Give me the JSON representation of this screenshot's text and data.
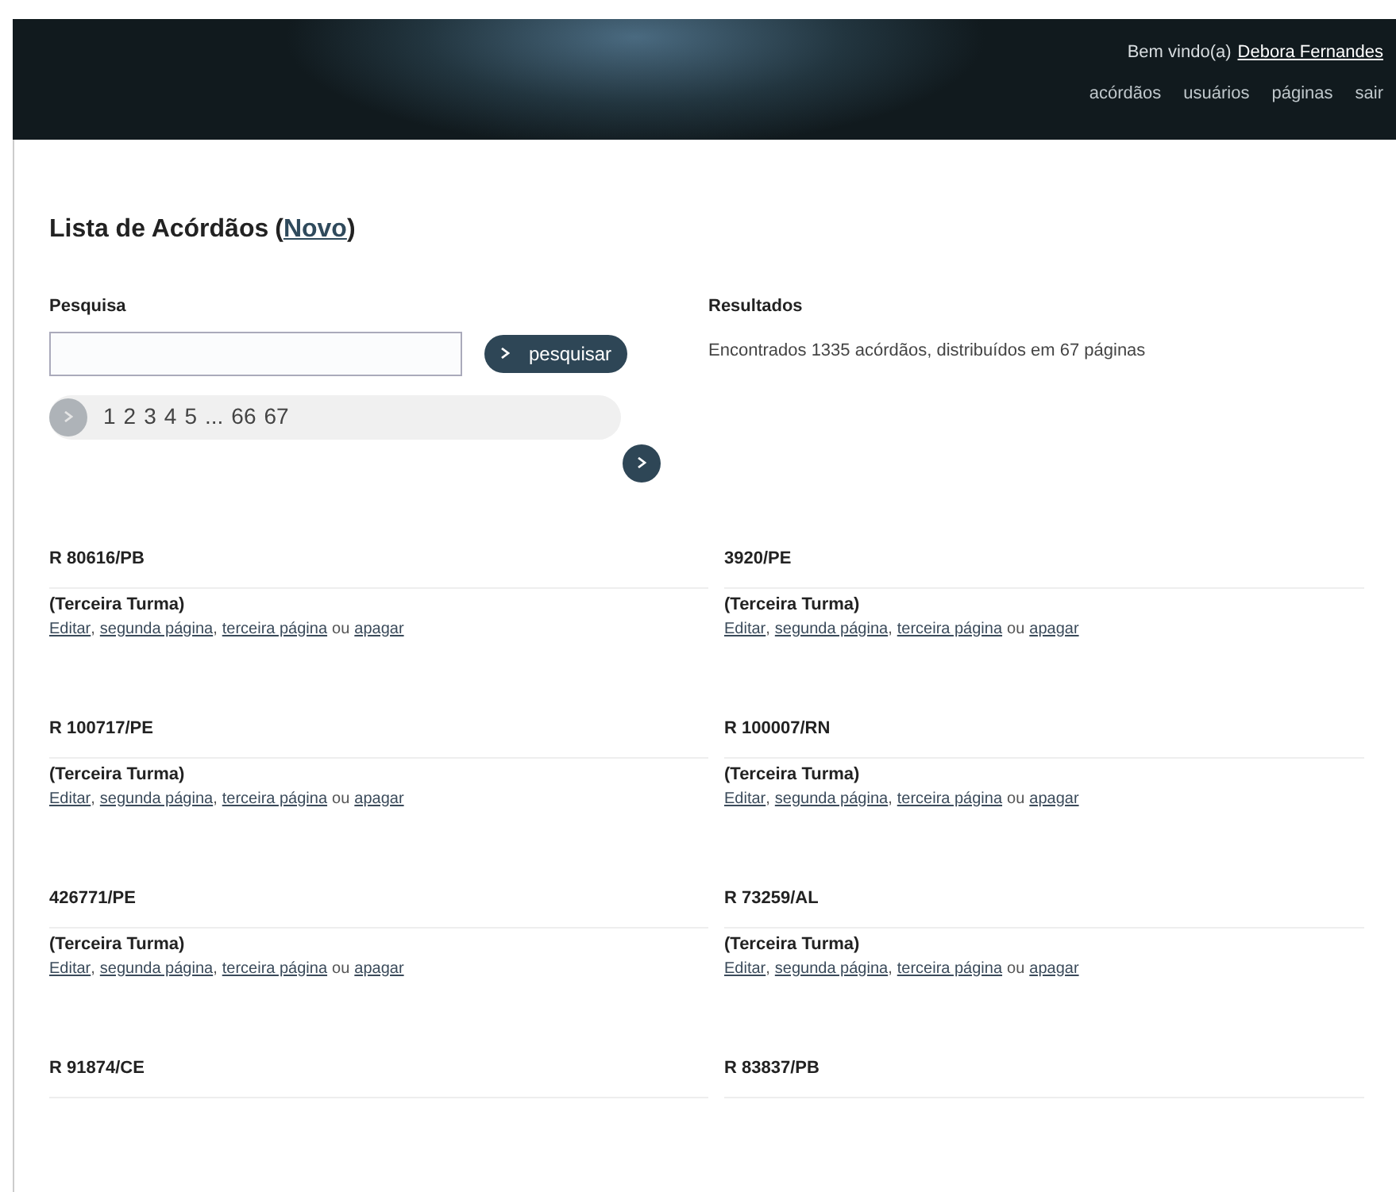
{
  "header": {
    "greeting": "Bem vindo(a)",
    "user": "Debora Fernandes",
    "nav": [
      "acórdãos",
      "usuários",
      "páginas",
      "sair"
    ]
  },
  "title": {
    "text": "Lista de Acórdãos",
    "paren_open": "(",
    "link": "Novo",
    "paren_close": ")"
  },
  "search": {
    "label": "Pesquisa",
    "button": "pesquisar"
  },
  "results": {
    "label": "Resultados",
    "text": "Encontrados 1335 acórdãos, distribuídos em 67 páginas"
  },
  "pagination": {
    "prev_disabled": true,
    "pages": [
      "1",
      "2",
      "3",
      "4",
      "5",
      "...",
      "66",
      "67"
    ],
    "next_disabled": false
  },
  "items": [
    {
      "code": "R 80616/PB",
      "turma": "(Terceira Turma)",
      "actions": [
        {
          "kind": "link",
          "text": "Editar"
        },
        {
          "kind": "text",
          "text": ","
        },
        {
          "kind": "link",
          "text": "segunda página"
        },
        {
          "kind": "text",
          "text": ","
        },
        {
          "kind": "link",
          "text": "terceira página"
        },
        {
          "kind": "text",
          "text": "ou"
        },
        {
          "kind": "link",
          "text": "apagar"
        }
      ]
    },
    {
      "code": "3920/PE",
      "turma": "(Terceira Turma)",
      "actions": [
        {
          "kind": "link",
          "text": "Editar"
        },
        {
          "kind": "text",
          "text": ","
        },
        {
          "kind": "link",
          "text": "segunda página"
        },
        {
          "kind": "text",
          "text": ","
        },
        {
          "kind": "link",
          "text": "terceira página"
        },
        {
          "kind": "text",
          "text": "ou"
        },
        {
          "kind": "link",
          "text": "apagar"
        }
      ]
    },
    {
      "code": "R 100717/PE",
      "turma": "(Terceira Turma)",
      "actions": [
        {
          "kind": "link",
          "text": "Editar"
        },
        {
          "kind": "text",
          "text": ","
        },
        {
          "kind": "link",
          "text": "segunda página"
        },
        {
          "kind": "text",
          "text": ","
        },
        {
          "kind": "link",
          "text": "terceira página"
        },
        {
          "kind": "text",
          "text": "ou"
        },
        {
          "kind": "link",
          "text": "apagar"
        }
      ]
    },
    {
      "code": "R 100007/RN",
      "turma": "(Terceira Turma)",
      "actions": [
        {
          "kind": "link",
          "text": "Editar"
        },
        {
          "kind": "text",
          "text": ","
        },
        {
          "kind": "link",
          "text": "segunda página"
        },
        {
          "kind": "text",
          "text": ","
        },
        {
          "kind": "link",
          "text": "terceira página"
        },
        {
          "kind": "text",
          "text": "ou"
        },
        {
          "kind": "link",
          "text": "apagar"
        }
      ]
    },
    {
      "code": "426771/PE",
      "turma": "(Terceira Turma)",
      "actions": [
        {
          "kind": "link",
          "text": "Editar"
        },
        {
          "kind": "text",
          "text": ","
        },
        {
          "kind": "link",
          "text": "segunda página"
        },
        {
          "kind": "text",
          "text": ","
        },
        {
          "kind": "link",
          "text": "terceira página"
        },
        {
          "kind": "text",
          "text": "ou"
        },
        {
          "kind": "link",
          "text": "apagar"
        }
      ]
    },
    {
      "code": "R 73259/AL",
      "turma": "(Terceira Turma)",
      "actions": [
        {
          "kind": "link",
          "text": "Editar"
        },
        {
          "kind": "text",
          "text": ","
        },
        {
          "kind": "link",
          "text": "segunda página"
        },
        {
          "kind": "text",
          "text": ","
        },
        {
          "kind": "link",
          "text": "terceira página"
        },
        {
          "kind": "text",
          "text": "ou"
        },
        {
          "kind": "link",
          "text": "apagar"
        }
      ]
    },
    {
      "code": "R 91874/CE"
    },
    {
      "code": "R 83837/PB"
    }
  ]
}
